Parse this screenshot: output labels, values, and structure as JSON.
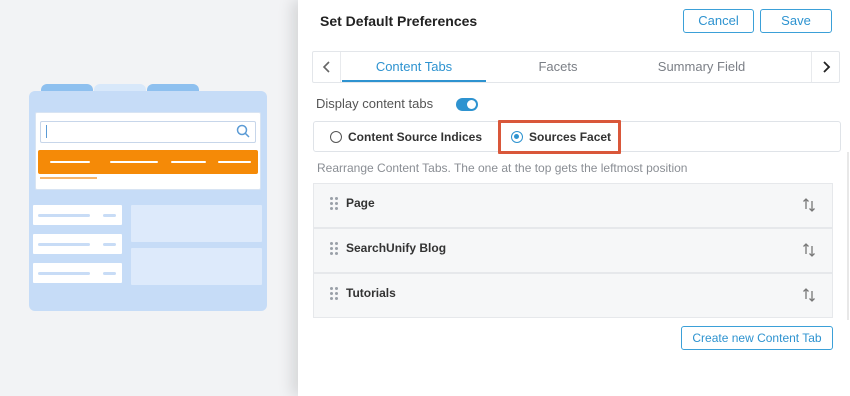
{
  "panel": {
    "title": "Set Default Preferences",
    "cancel_label": "Cancel",
    "save_label": "Save"
  },
  "tabs": [
    {
      "label": "Content Tabs",
      "active": true
    },
    {
      "label": "Facets",
      "active": false
    },
    {
      "label": "Summary Field",
      "active": false
    }
  ],
  "display_content_tabs": {
    "label": "Display content tabs",
    "enabled": true
  },
  "source_options": [
    {
      "label": "Content Source Indices",
      "checked": false
    },
    {
      "label": "Sources Facet",
      "checked": true
    }
  ],
  "hint": "Rearrange Content Tabs. The one at the top gets the leftmost position",
  "content_tabs": [
    {
      "label": "Page"
    },
    {
      "label": "SearchUnify Blog"
    },
    {
      "label": "Tutorials"
    }
  ],
  "create_button_label": "Create new Content Tab",
  "colors": {
    "accent": "#2e93d0",
    "highlight": "#d9573a",
    "illustration_orange": "#f58a07"
  },
  "icons": [
    "chevron-left-icon",
    "chevron-right-icon",
    "drag-handle-icon",
    "sort-arrows-icon",
    "search-icon"
  ]
}
